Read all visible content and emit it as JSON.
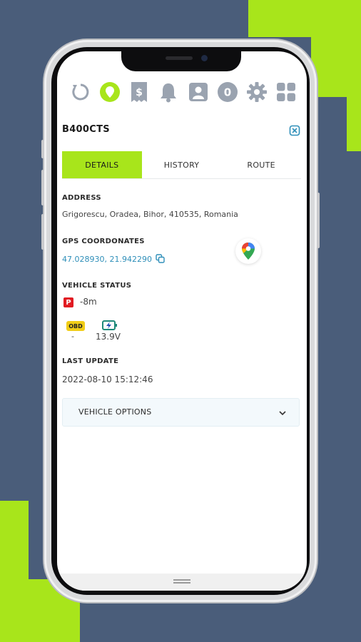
{
  "background": {
    "navy": "#4a5d7a",
    "accent": "#a8e51b"
  },
  "toolbar": {
    "icons": [
      "refresh-icon",
      "location-pin-icon",
      "invoice-icon",
      "bell-icon",
      "contact-icon",
      "zero-badge-icon",
      "gear-icon",
      "grid-icon"
    ],
    "badge_value": "0",
    "invoice_symbol": "$"
  },
  "vehicle": {
    "plate": "B400CTS"
  },
  "tabs": [
    "DETAILS",
    "HISTORY",
    "ROUTE"
  ],
  "active_tab": "DETAILS",
  "details": {
    "address_label": "ADDRESS",
    "address_value": "Grigorescu, Oradea, Bihor, 410535, Romania",
    "gps_label": "GPS COORDONATES",
    "gps_value": "47.028930, 21.942290",
    "status_label": "VEHICLE STATUS",
    "park_badge": "P",
    "park_time": "-8m",
    "obd_label": "OBD",
    "obd_value": "-",
    "battery_value": "13.9V",
    "last_update_label": "LAST UPDATE",
    "last_update_value": "2022-08-10 15:12:46",
    "options_label": "VEHICLE OPTIONS"
  }
}
